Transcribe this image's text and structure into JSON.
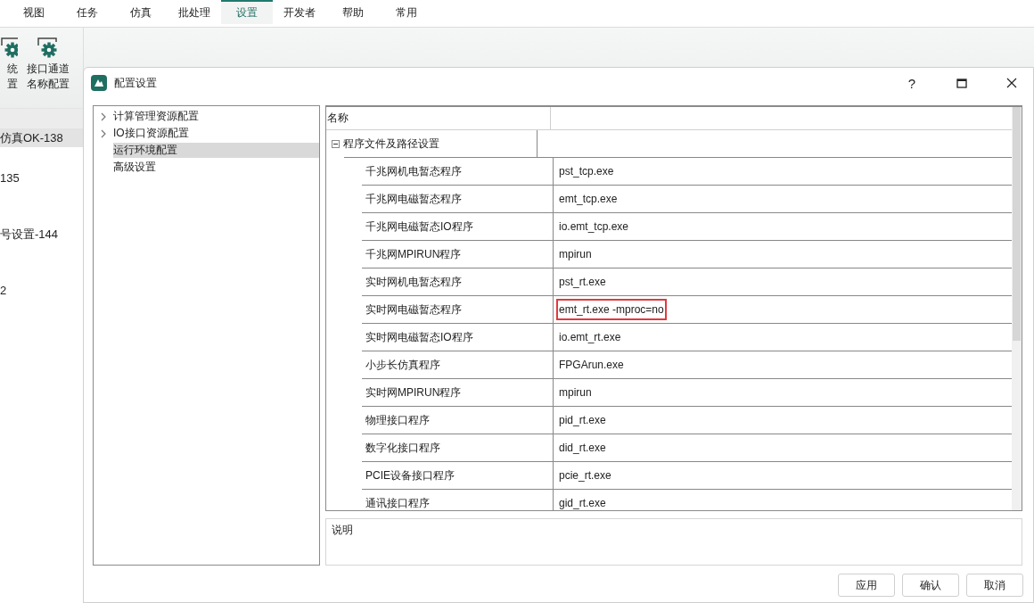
{
  "menu_tabs": [
    {
      "label": "视图",
      "selected": false
    },
    {
      "label": "任务",
      "selected": false
    },
    {
      "label": "仿真",
      "selected": false
    },
    {
      "label": "批处理",
      "selected": false
    },
    {
      "label": "设置",
      "selected": true
    },
    {
      "label": "开发者",
      "selected": false
    },
    {
      "label": "帮助",
      "selected": false
    },
    {
      "label": "常用",
      "selected": false
    }
  ],
  "ribbon_buttons": [
    {
      "lines": [
        "统",
        "置"
      ]
    },
    {
      "lines": [
        "接口通道",
        "名称配置"
      ]
    }
  ],
  "background_list": [
    {
      "label": "仿真OK-138",
      "selected": true
    },
    {
      "label": "135",
      "selected": false
    },
    {
      "label": "号设置-144",
      "selected": false
    },
    {
      "label": "2",
      "selected": false
    }
  ],
  "dialog": {
    "title": "配置设置",
    "help": "?",
    "tree": [
      {
        "label": "计算管理资源配置",
        "expandable": true,
        "selected": false
      },
      {
        "label": "IO接口资源配置",
        "expandable": true,
        "selected": false
      },
      {
        "label": "运行环境配置",
        "expandable": false,
        "selected": true
      },
      {
        "label": "高级设置",
        "expandable": false,
        "selected": false
      }
    ],
    "grid": {
      "header": "名称",
      "category": {
        "label": "程序文件及路径设置",
        "expanded": true
      },
      "rows": [
        {
          "name": "千兆网机电暂态程序",
          "value": "pst_tcp.exe",
          "highlighted": false
        },
        {
          "name": "千兆网电磁暂态程序",
          "value": "emt_tcp.exe",
          "highlighted": false
        },
        {
          "name": "千兆网电磁暂态IO程序",
          "value": "io.emt_tcp.exe",
          "highlighted": false
        },
        {
          "name": "千兆网MPIRUN程序",
          "value": "mpirun",
          "highlighted": false
        },
        {
          "name": "实时网机电暂态程序",
          "value": "pst_rt.exe",
          "highlighted": false
        },
        {
          "name": "实时网电磁暂态程序",
          "value": "emt_rt.exe -mproc=no",
          "highlighted": true
        },
        {
          "name": "实时网电磁暂态IO程序",
          "value": "io.emt_rt.exe",
          "highlighted": false
        },
        {
          "name": "小步长仿真程序",
          "value": "FPGArun.exe",
          "highlighted": false
        },
        {
          "name": "实时网MPIRUN程序",
          "value": "mpirun",
          "highlighted": false
        },
        {
          "name": "物理接口程序",
          "value": "pid_rt.exe",
          "highlighted": false
        },
        {
          "name": "数字化接口程序",
          "value": "did_rt.exe",
          "highlighted": false
        },
        {
          "name": "PCIE设备接口程序",
          "value": "pcie_rt.exe",
          "highlighted": false
        },
        {
          "name": "通讯接口程序",
          "value": "gid_rt.exe",
          "highlighted": false
        }
      ]
    },
    "description_label": "说明",
    "buttons": [
      "应用",
      "确认",
      "取消"
    ]
  }
}
